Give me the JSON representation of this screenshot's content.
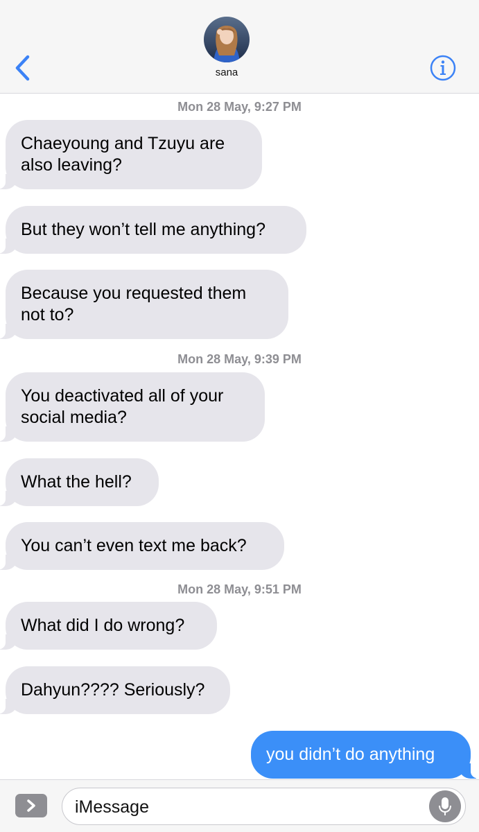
{
  "header": {
    "contact_name": "sana",
    "back_icon": "chevron-left-icon",
    "info_icon": "info-circle-icon",
    "accent_color": "#3b82f6"
  },
  "thread": {
    "timestamps": [
      {
        "day": "Mon 28 May,",
        "time": "9:27 PM"
      },
      {
        "day": "Mon 28 May,",
        "time": "9:39 PM"
      },
      {
        "day": "Mon 28 May,",
        "time": "9:51 PM"
      }
    ],
    "messages": [
      {
        "direction": "incoming",
        "lines": [
          "Chaeyoung and Tzuyu are",
          "also leaving?"
        ]
      },
      {
        "direction": "incoming",
        "lines": [
          "But they won’t tell me anything?"
        ]
      },
      {
        "direction": "incoming",
        "lines": [
          "Because you requested them",
          "not to?"
        ]
      },
      {
        "direction": "incoming",
        "lines": [
          "You deactivated all of your",
          "social media?"
        ]
      },
      {
        "direction": "incoming",
        "lines": [
          "What the hell?"
        ]
      },
      {
        "direction": "incoming",
        "lines": [
          "You can’t even text me back?"
        ]
      },
      {
        "direction": "incoming",
        "lines": [
          "What did I do wrong?"
        ]
      },
      {
        "direction": "incoming",
        "lines": [
          "Dahyun???? Seriously?"
        ]
      },
      {
        "direction": "outgoing",
        "lines": [
          "you didn’t do anything"
        ]
      }
    ],
    "incoming_bubble_color": "#e6e5eb",
    "outgoing_bubble_color": "#3b8ff8"
  },
  "composer": {
    "placeholder": "iMessage",
    "apps_icon": "chevron-right-icon",
    "mic_icon": "microphone-icon"
  }
}
